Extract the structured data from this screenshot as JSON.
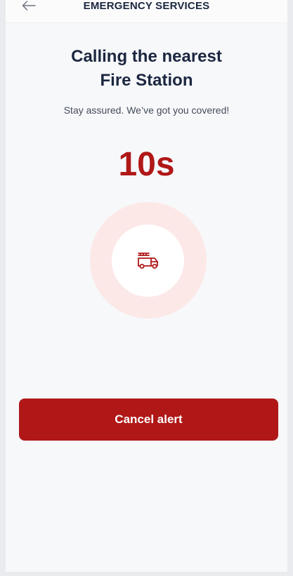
{
  "header": {
    "title": "EMERGENCY SERVICES",
    "back_icon": "arrow-left-icon"
  },
  "main": {
    "title_line1": "Calling the nearest",
    "title_line2": "Fire Station",
    "subtitle": "Stay assured. We’ve got you covered!",
    "countdown": "10s",
    "center_icon": "fire-truck-icon"
  },
  "actions": {
    "cancel_label": "Cancel alert"
  },
  "colors": {
    "accent": "#b01818",
    "pulse": "#fde8e8",
    "text_dark": "#1b2740"
  }
}
